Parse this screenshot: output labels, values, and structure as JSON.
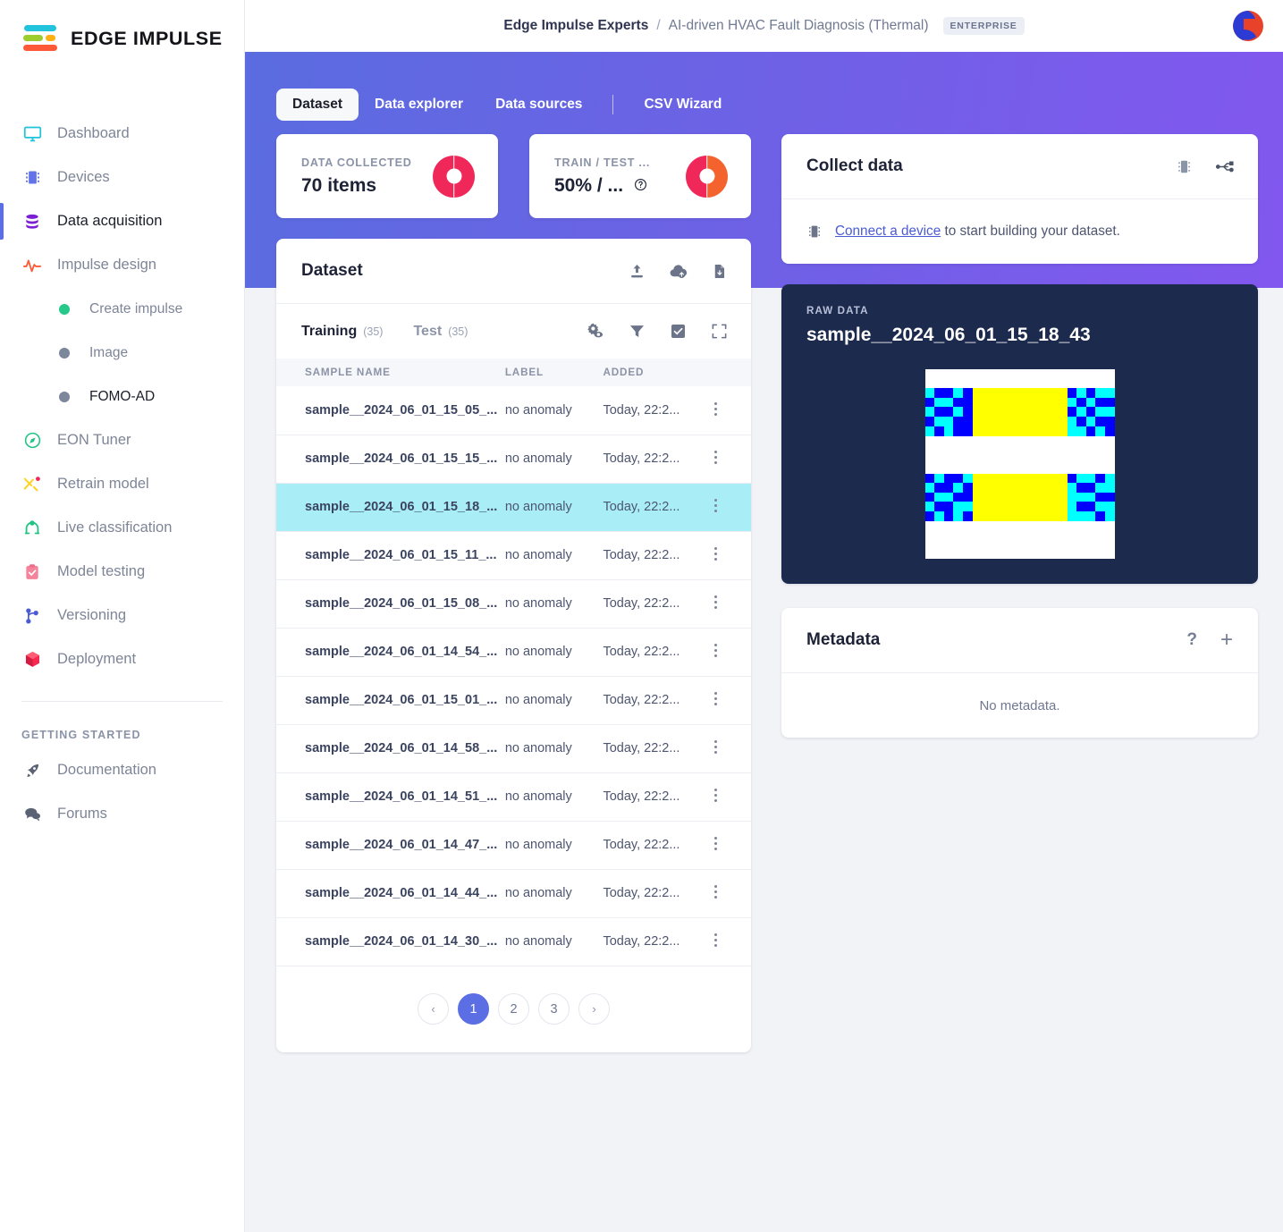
{
  "brand": {
    "name": "EDGE IMPULSE"
  },
  "sidebar": {
    "items": [
      {
        "label": "Dashboard",
        "icon": "monitor-icon"
      },
      {
        "label": "Devices",
        "icon": "chip-icon"
      },
      {
        "label": "Data acquisition",
        "icon": "database-icon"
      },
      {
        "label": "Impulse design",
        "icon": "pulse-icon"
      }
    ],
    "sub_items": [
      {
        "label": "Create impulse",
        "dot": "#27c98a"
      },
      {
        "label": "Image",
        "dot": "#7c879c"
      },
      {
        "label": "FOMO-AD",
        "dot": "#7c879c"
      }
    ],
    "items2": [
      {
        "label": "EON Tuner",
        "icon": "compass-icon"
      },
      {
        "label": "Retrain model",
        "icon": "shuffle-icon"
      },
      {
        "label": "Live classification",
        "icon": "broadcast-icon"
      },
      {
        "label": "Model testing",
        "icon": "clipboard-check-icon"
      },
      {
        "label": "Versioning",
        "icon": "branch-icon"
      },
      {
        "label": "Deployment",
        "icon": "box-icon"
      }
    ],
    "getting_started_label": "GETTING STARTED",
    "items3": [
      {
        "label": "Documentation",
        "icon": "rocket-icon"
      },
      {
        "label": "Forums",
        "icon": "chat-icon"
      }
    ]
  },
  "header": {
    "org": "Edge Impulse Experts",
    "separator": "/",
    "project": "AI-driven HVAC Fault Diagnosis (Thermal)",
    "plan_badge": "ENTERPRISE"
  },
  "tabs": [
    {
      "label": "Dataset",
      "active": true
    },
    {
      "label": "Data explorer",
      "active": false
    },
    {
      "label": "Data sources",
      "active": false
    },
    {
      "label": "CSV Wizard",
      "active": false,
      "after_separator": true
    }
  ],
  "stats": [
    {
      "label": "DATA COLLECTED",
      "value": "70 items",
      "has_help": false,
      "donut": {
        "type": "single",
        "colors": [
          "#f0285a"
        ]
      }
    },
    {
      "label": "TRAIN / TEST ...",
      "value": "50% / ...",
      "has_help": true,
      "help": "?",
      "donut": {
        "type": "split",
        "colors": [
          "#f0285a",
          "#f4622e"
        ]
      }
    }
  ],
  "dataset_panel": {
    "title": "Dataset",
    "head_icons": [
      "upload-icon",
      "cloud-upload-icon",
      "file-download-icon"
    ],
    "subtabs": [
      {
        "label": "Training",
        "count": "(35)",
        "active": true
      },
      {
        "label": "Test",
        "count": "(35)",
        "active": false
      }
    ],
    "tool_icons": [
      "gear-eye-icon",
      "filter-icon",
      "checkbox-icon",
      "expand-icon"
    ],
    "columns": [
      "SAMPLE NAME",
      "LABEL",
      "ADDED",
      ""
    ],
    "rows": [
      {
        "name": "sample__2024_06_01_15_05_...",
        "label": "no anomaly",
        "added": "Today, 22:2...",
        "selected": false
      },
      {
        "name": "sample__2024_06_01_15_15_...",
        "label": "no anomaly",
        "added": "Today, 22:2...",
        "selected": false
      },
      {
        "name": "sample__2024_06_01_15_18_...",
        "label": "no anomaly",
        "added": "Today, 22:2...",
        "selected": true
      },
      {
        "name": "sample__2024_06_01_15_11_...",
        "label": "no anomaly",
        "added": "Today, 22:2...",
        "selected": false
      },
      {
        "name": "sample__2024_06_01_15_08_...",
        "label": "no anomaly",
        "added": "Today, 22:2...",
        "selected": false
      },
      {
        "name": "sample__2024_06_01_14_54_...",
        "label": "no anomaly",
        "added": "Today, 22:2...",
        "selected": false
      },
      {
        "name": "sample__2024_06_01_15_01_...",
        "label": "no anomaly",
        "added": "Today, 22:2...",
        "selected": false
      },
      {
        "name": "sample__2024_06_01_14_58_...",
        "label": "no anomaly",
        "added": "Today, 22:2...",
        "selected": false
      },
      {
        "name": "sample__2024_06_01_14_51_...",
        "label": "no anomaly",
        "added": "Today, 22:2...",
        "selected": false
      },
      {
        "name": "sample__2024_06_01_14_47_...",
        "label": "no anomaly",
        "added": "Today, 22:2...",
        "selected": false
      },
      {
        "name": "sample__2024_06_01_14_44_...",
        "label": "no anomaly",
        "added": "Today, 22:2...",
        "selected": false
      },
      {
        "name": "sample__2024_06_01_14_30_...",
        "label": "no anomaly",
        "added": "Today, 22:2...",
        "selected": false
      }
    ],
    "pagination": {
      "prev": "‹",
      "pages": [
        "1",
        "2",
        "3"
      ],
      "current": "1",
      "next": "›"
    }
  },
  "collect_data": {
    "title": "Collect data",
    "head_icons": [
      "chip-icon",
      "usb-icon"
    ],
    "link_text": "Connect a device",
    "rest_text": " to start building your dataset."
  },
  "raw_data": {
    "label": "RAW DATA",
    "title": "sample__2024_06_01_15_18_43",
    "image_colors": {
      "background": "#ffffff",
      "hot": "#ffff00",
      "cold": "#0000ff",
      "mid": "#00ffff"
    }
  },
  "metadata": {
    "title": "Metadata",
    "icons": [
      "help-icon",
      "plus-icon"
    ],
    "empty_text": "No metadata."
  },
  "colors": {
    "accent_purple": "#5b6ee4",
    "gradient_start": "#5a6ce0",
    "gradient_end": "#8257ef",
    "selected_row": "#a9eef7",
    "raw_panel": "#1c2a4e"
  }
}
